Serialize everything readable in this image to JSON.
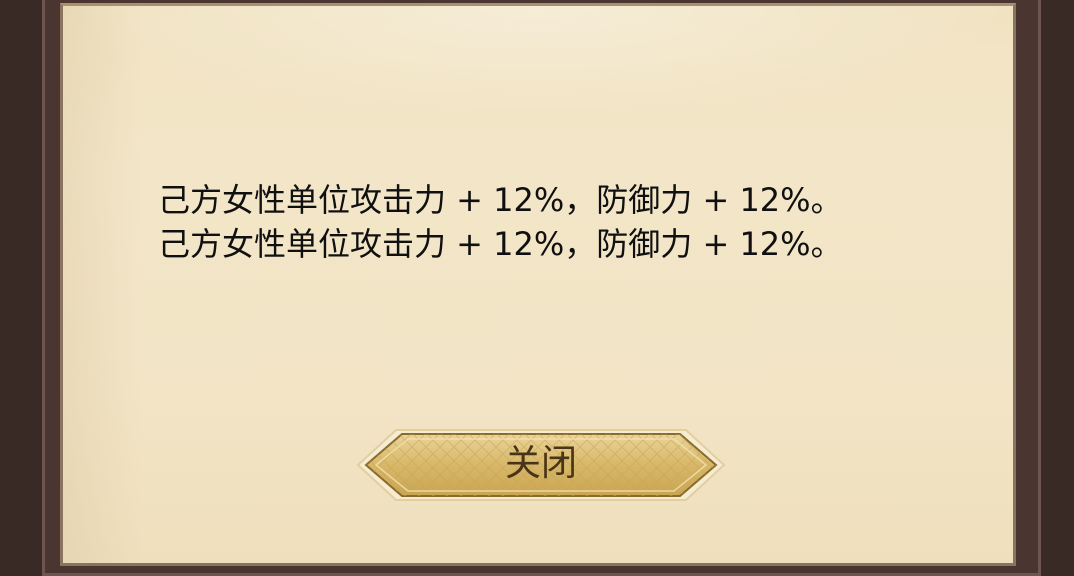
{
  "dialog": {
    "descriptions": [
      "己方女性单位攻击力 + 12%，防御力 + 12%。",
      "己方女性单位攻击力 + 12%，防御力 + 12%。"
    ],
    "close_label": "关闭"
  },
  "colors": {
    "frame": "#4a3530",
    "parchment": "#f2e4c5",
    "text": "#101010",
    "button_gold": "#d8b868",
    "button_label": "#4a3417"
  }
}
